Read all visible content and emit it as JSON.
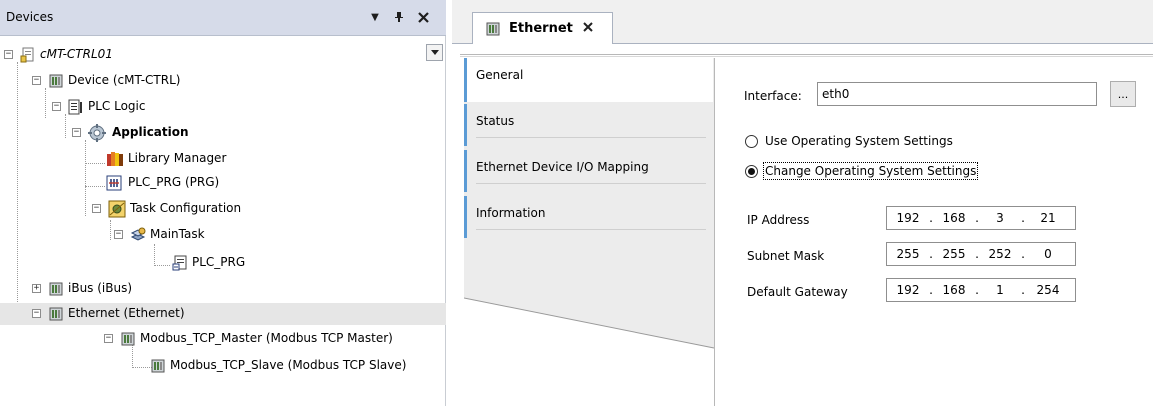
{
  "devices_pane": {
    "title": "Devices",
    "buttons": {
      "dropdown": "▾",
      "pin": "ᵖ",
      "close": "✕"
    },
    "tree": [
      {
        "label": "cMT-CTRL01",
        "icon": "project-icon"
      },
      {
        "label": "Device (cMT-CTRL)",
        "icon": "device-icon"
      },
      {
        "label": "PLC Logic",
        "icon": "plc-logic-icon"
      },
      {
        "label": "Application",
        "icon": "application-icon"
      },
      {
        "label": "Library Manager",
        "icon": "library-manager-icon"
      },
      {
        "label": "PLC_PRG (PRG)",
        "icon": "pou-icon"
      },
      {
        "label": "Task Configuration",
        "icon": "task-configuration-icon"
      },
      {
        "label": "MainTask",
        "icon": "task-icon"
      },
      {
        "label": "PLC_PRG",
        "icon": "program-call-icon"
      },
      {
        "label": "iBus (iBus)",
        "icon": "device-icon"
      },
      {
        "label": "Ethernet (Ethernet)",
        "icon": "device-icon"
      },
      {
        "label": "Modbus_TCP_Master (Modbus TCP Master)",
        "icon": "device-icon"
      },
      {
        "label": "Modbus_TCP_Slave (Modbus TCP Slave)",
        "icon": "device-icon"
      }
    ]
  },
  "editor": {
    "tab": {
      "label": "Ethernet",
      "close": "✕"
    },
    "side_tabs": [
      {
        "label": "General"
      },
      {
        "label": "Status"
      },
      {
        "label": "Ethernet Device I/O Mapping"
      },
      {
        "label": "Information"
      }
    ],
    "form": {
      "interface_label": "Interface:",
      "interface_value": "eth0",
      "browse_button": "...",
      "radio_os_settings": "Use Operating System Settings",
      "radio_change_settings": "Change Operating System Settings",
      "selected_radio": "Change Operating System Settings",
      "ip_address_label": "IP Address",
      "ip_address": [
        "192",
        "168",
        "3",
        "21"
      ],
      "subnet_mask_label": "Subnet Mask",
      "subnet_mask": [
        "255",
        "255",
        "252",
        "0"
      ],
      "default_gateway_label": "Default Gateway",
      "default_gateway": [
        "192",
        "168",
        "1",
        "254"
      ]
    }
  },
  "colors": {
    "pane_header": "#d6dbe9",
    "tab_accent": "#5b9bd5",
    "selected_row": "#e6e6e6"
  }
}
